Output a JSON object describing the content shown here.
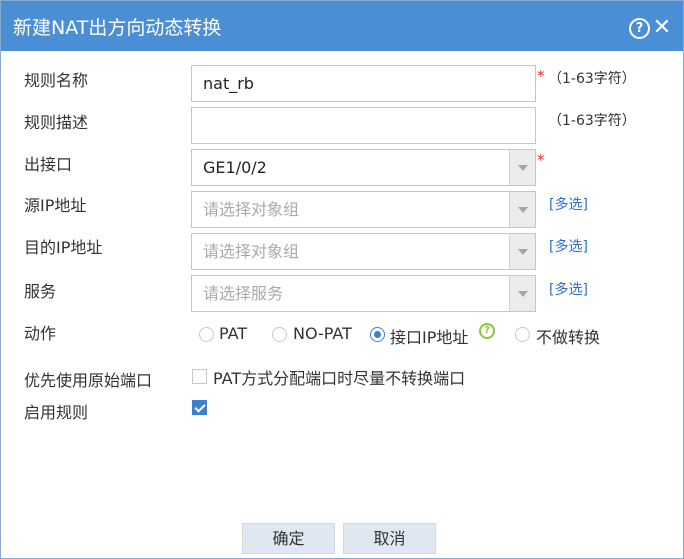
{
  "dialog": {
    "title": "新建NAT出方向动态转换",
    "help_icon": "question-circle-icon",
    "close_icon": "close-icon",
    "help_glyph": "?",
    "close_glyph": "✕"
  },
  "form": {
    "rule_name": {
      "label": "规则名称",
      "value": "nat_rb",
      "required": "*",
      "hint": "（1-63字符）"
    },
    "rule_desc": {
      "label": "规则描述",
      "value": "",
      "hint": "（1-63字符）"
    },
    "egress": {
      "label": "出接口",
      "value": "GE1/0/2",
      "required": "*"
    },
    "src_ip": {
      "label": "源IP地址",
      "placeholder": "请选择对象组",
      "link": "[多选]"
    },
    "dst_ip": {
      "label": "目的IP地址",
      "placeholder": "请选择对象组",
      "link": "[多选]"
    },
    "service": {
      "label": "服务",
      "placeholder": "请选择服务",
      "link": "[多选]"
    },
    "action": {
      "label": "动作",
      "options": [
        "PAT",
        "NO-PAT",
        "接口IP地址",
        "不做转换"
      ],
      "selected": "接口IP地址",
      "help_glyph": "?"
    },
    "prefer_port": {
      "label": "优先使用原始端口",
      "option": "PAT方式分配端口时尽量不转换端口",
      "checked": false
    },
    "enable": {
      "label": "启用规则",
      "checked": true
    }
  },
  "buttons": {
    "ok": "确定",
    "cancel": "取消"
  },
  "colors": {
    "titlebar": "#4a8fd6",
    "accent": "#3c7fd0",
    "required": "#e03030",
    "link": "#2f6fcf",
    "help_green": "#8cc63f",
    "button_bg": "#dfe7f1"
  }
}
